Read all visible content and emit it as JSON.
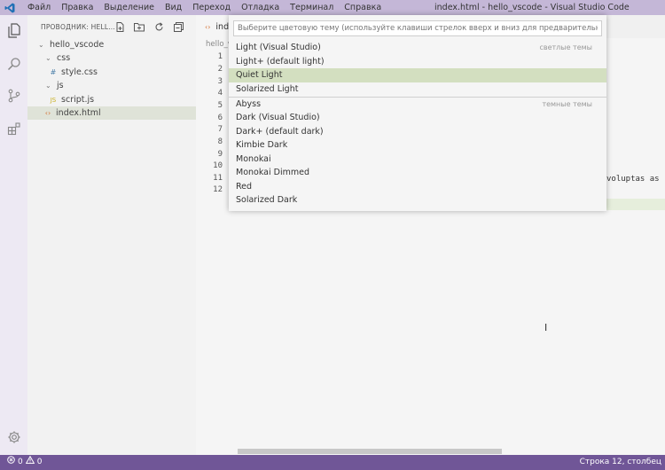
{
  "titlebar": {
    "menu": [
      "Файл",
      "Правка",
      "Выделение",
      "Вид",
      "Переход",
      "Отладка",
      "Терминал",
      "Справка"
    ],
    "window_title": "index.html - hello_vscode - Visual Studio Code"
  },
  "activitybar": {
    "icons": [
      "files-icon",
      "search-icon",
      "source-control-icon",
      "extensions-icon",
      "gear-icon"
    ]
  },
  "sidebar": {
    "header": "ПРОВОДНИК: HELL...",
    "tree": [
      {
        "label": "hello_vscode",
        "icon": "chevron-down-icon",
        "depth": 0
      },
      {
        "label": "css",
        "icon": "chevron-down-icon",
        "depth": 1
      },
      {
        "label": "style.css",
        "icon": "hash-icon",
        "depth": 2
      },
      {
        "label": "js",
        "icon": "chevron-down-icon",
        "depth": 1
      },
      {
        "label": "script.js",
        "icon": "js-icon",
        "depth": 2
      },
      {
        "label": "index.html",
        "icon": "html-icon",
        "depth": 1,
        "selected": true
      }
    ]
  },
  "editor": {
    "tab_label": "inde",
    "breadcrumb": "hello_v",
    "line_numbers": [
      "1",
      "2",
      "3",
      "4",
      "5",
      "6",
      "7",
      "8",
      "9",
      "10",
      "11",
      "12"
    ],
    "code_fragment": "voluptas as"
  },
  "quickpick": {
    "placeholder": "Выберите цветовую тему (используйте клавиши стрелок вверх и вниз для предварительного пр",
    "light_group_label": "светлые темы",
    "dark_group_label": "темные темы",
    "light_themes": [
      "Light (Visual Studio)",
      "Light+ (default light)",
      "Quiet Light",
      "Solarized Light"
    ],
    "dark_themes": [
      "Abyss",
      "Dark (Visual Studio)",
      "Dark+ (default dark)",
      "Kimbie Dark",
      "Monokai",
      "Monokai Dimmed",
      "Red",
      "Solarized Dark"
    ],
    "active_item": "Quiet Light"
  },
  "statusbar": {
    "errors": "0",
    "warnings": "0",
    "position": "Строка 12, столбец"
  },
  "colors": {
    "titlebar": "#c4b7d7",
    "statusbar": "#705697",
    "active_item": "#d3dfc0",
    "selected_tree_row": "#dfe3d8"
  }
}
